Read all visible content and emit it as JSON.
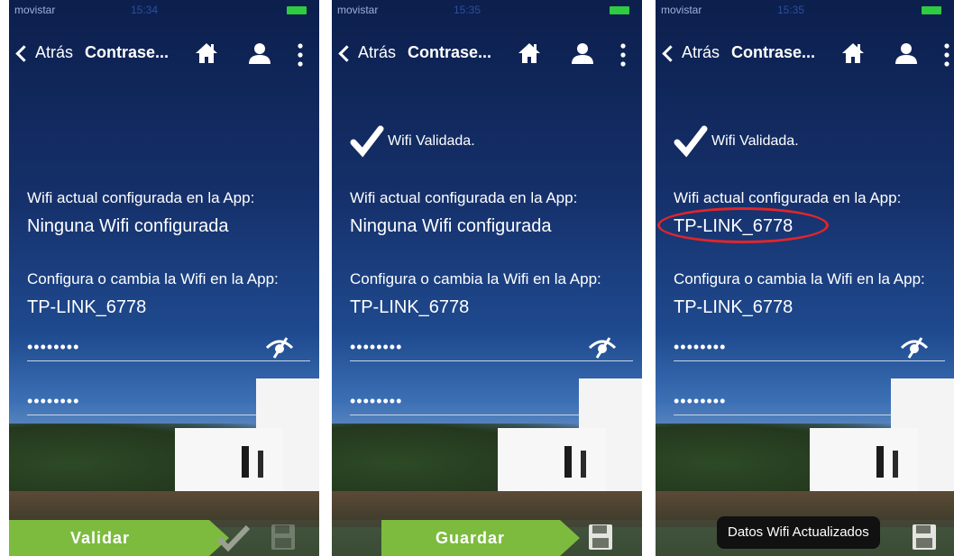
{
  "status": {
    "carrier": "movistar",
    "time_p1": "15:34",
    "time_p2": "15:35",
    "time_p3": "15:35"
  },
  "nav": {
    "back_label": "Atrás",
    "title": "Contrase..."
  },
  "screens": [
    {
      "validated_text": "",
      "current_wifi_label": "Wifi actual configurada en la App:",
      "current_wifi_value": "Ninguna Wifi configurada",
      "config_label": "Configura o cambia la Wifi en la App:",
      "config_value": "TP-LINK_6778",
      "password_mask_1": "••••••••",
      "password_mask_2": "••••••••",
      "action_label": "Validar"
    },
    {
      "validated_text": "Wifi Validada.",
      "current_wifi_label": "Wifi actual configurada en la App:",
      "current_wifi_value": "Ninguna Wifi configurada",
      "config_label": "Configura o cambia la Wifi en la App:",
      "config_value": "TP-LINK_6778",
      "password_mask_1": "••••••••",
      "password_mask_2": "••••••••",
      "action_label": "Guardar"
    },
    {
      "validated_text": "Wifi Validada.",
      "current_wifi_label": "Wifi actual configurada en la App:",
      "current_wifi_value": "TP-LINK_6778",
      "config_label": "Configura o cambia la Wifi en la App:",
      "config_value": "TP-LINK_6778",
      "password_mask_1": "••••••••",
      "password_mask_2": "••••••••",
      "toast": "Datos Wifi Actualizados"
    }
  ],
  "colors": {
    "accent_green": "#7dbb3e",
    "highlight_red": "#e0262b",
    "battery_green": "#2ecc40"
  },
  "icons": [
    "home-icon",
    "user-icon",
    "more-icon",
    "eye-icon",
    "check-icon",
    "floppy-icon"
  ]
}
